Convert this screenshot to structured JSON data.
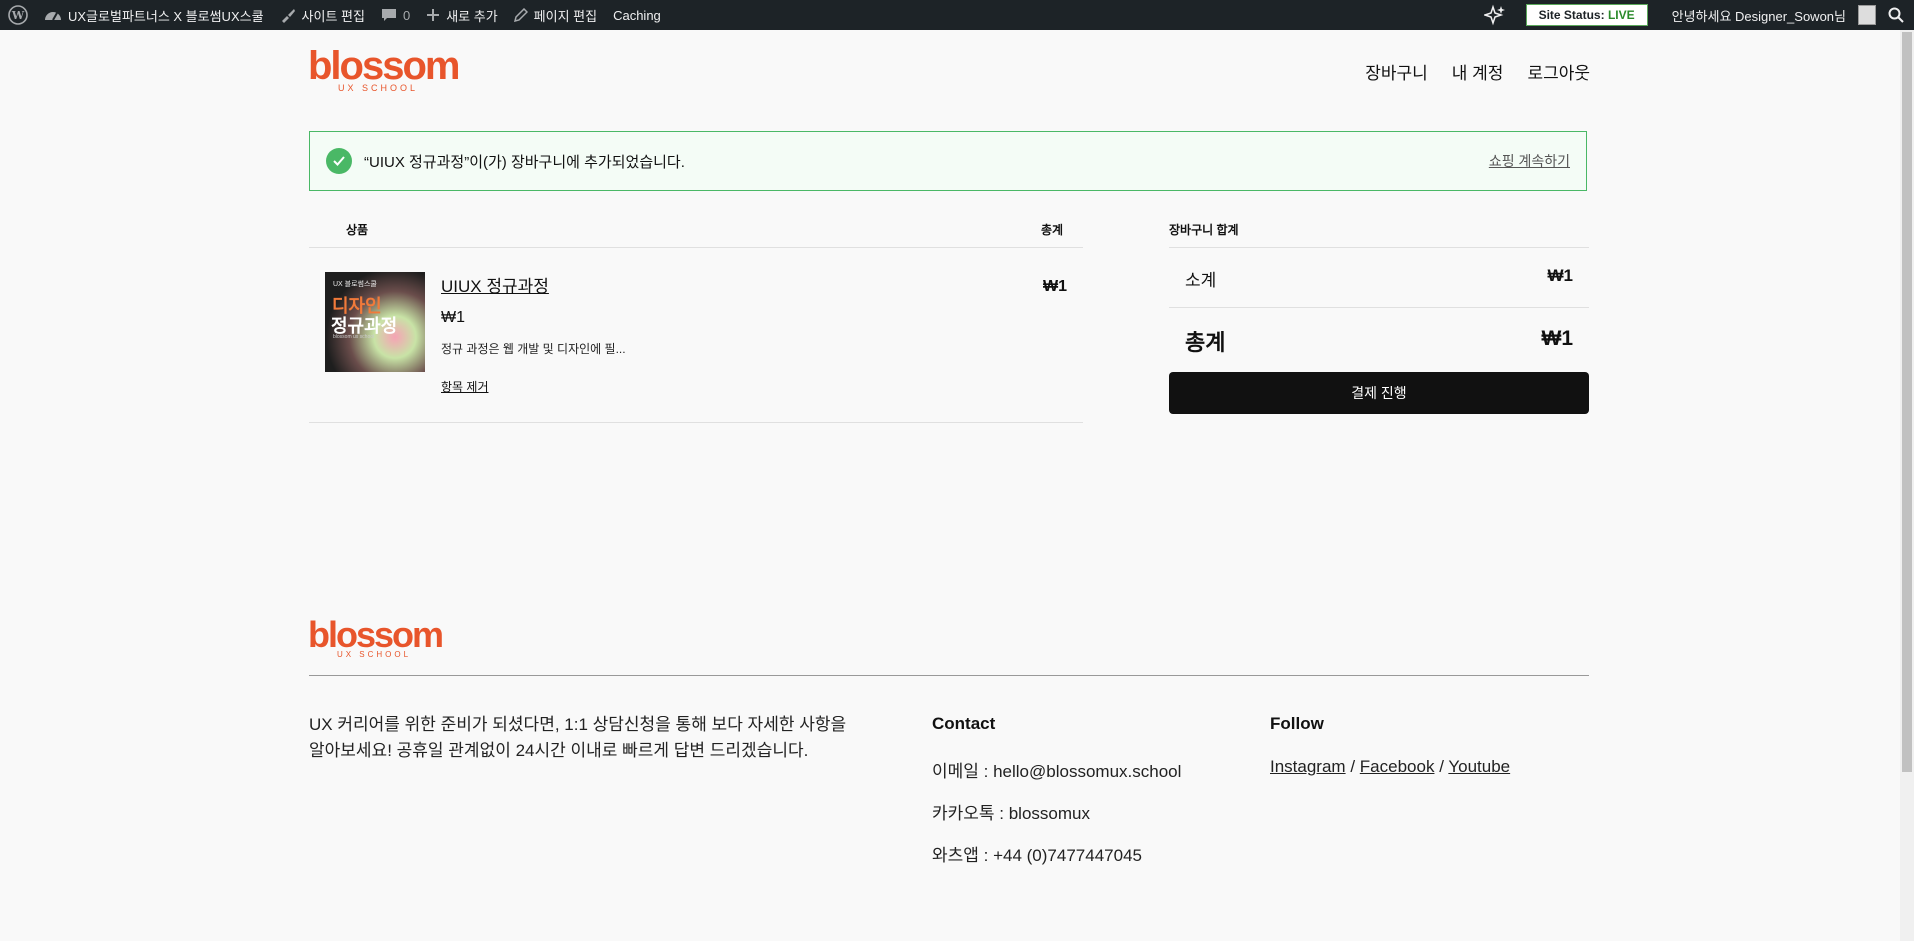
{
  "adminbar": {
    "site_name": "UX글로벌파트너스 X 블로썸UX스쿨",
    "site_edit": "사이트 편집",
    "comments_count": "0",
    "new_add": "새로 추가",
    "page_edit": "페이지 편집",
    "caching": "Caching",
    "site_status_label": "Site Status:",
    "site_status_value": "LIVE",
    "greeting": "안녕하세요 Designer_Sowon님"
  },
  "header": {
    "logo_word": "blossom",
    "logo_sub": "UX SCHOOL",
    "nav": [
      "장바구니",
      "내 계정",
      "로그아웃"
    ]
  },
  "notice": {
    "message": "“UIUX 정규과정”이(가) 장바구니에 추가되었습니다.",
    "link": "쇼핑 계속하기"
  },
  "cart": {
    "col_product": "상품",
    "col_total": "총계",
    "item": {
      "thumb_line1": "UX 블로썸스쿨",
      "thumb_line2": "디자인",
      "thumb_line3": "정규과정",
      "thumb_line4": "blossom ux school",
      "name": "UIUX 정규과정",
      "price": "₩1",
      "description": "정규 과정은 웹 개발 및 디자인에 필...",
      "remove": "항목 제거",
      "total": "₩1"
    }
  },
  "summary": {
    "title": "장바구니 합계",
    "subtotal_label": "소계",
    "subtotal_value": "₩1",
    "total_label": "총계",
    "total_value": "₩1",
    "checkout": "결제 진행"
  },
  "footer": {
    "logo_word": "blossom",
    "logo_sub": "UX SCHOOL",
    "description": "UX 커리어를 위한 준비가 되셨다면, 1:1 상담신청을 통해 보다 자세한 사항을 알아보세요! 공휴일 관계없이 24시간 이내로 빠르게 답변 드리겠습니다.",
    "contact_title": "Contact",
    "email": "이메일 : hello@blossomux.school",
    "kakao": "카카오톡 : blossomux",
    "whatsapp": "와츠앱 : +44 (0)7477447045",
    "follow_title": "Follow",
    "links": [
      "Instagram",
      "Facebook",
      "Youtube"
    ],
    "separator": "/"
  },
  "colors": {
    "brand": "#e8552b",
    "adminbar": "#1d2327",
    "notice_border": "#4ab866",
    "button": "#111111"
  }
}
